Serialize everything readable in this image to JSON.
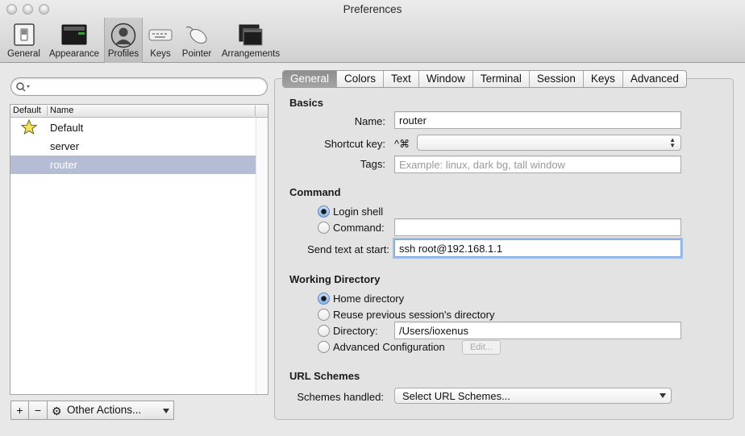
{
  "window": {
    "title": "Preferences"
  },
  "toolbar": {
    "items": [
      {
        "label": "General",
        "icon": "switch-icon"
      },
      {
        "label": "Appearance",
        "icon": "display-icon"
      },
      {
        "label": "Profiles",
        "icon": "user-silhouette-icon",
        "selected": true
      },
      {
        "label": "Keys",
        "icon": "keyboard-icon"
      },
      {
        "label": "Pointer",
        "icon": "mouse-icon"
      },
      {
        "label": "Arrangements",
        "icon": "windows-icon"
      }
    ]
  },
  "profiles_panel": {
    "search": {
      "placeholder": "",
      "value": ""
    },
    "columns": {
      "default": "Default",
      "name": "Name"
    },
    "profiles": [
      {
        "name": "Default",
        "is_default": true
      },
      {
        "name": "server",
        "is_default": false
      },
      {
        "name": "router",
        "is_default": false,
        "selected": true
      }
    ],
    "buttons": {
      "add": "+",
      "remove": "−",
      "other_actions": "Other Actions..."
    }
  },
  "tabs": [
    "General",
    "Colors",
    "Text",
    "Window",
    "Terminal",
    "Session",
    "Keys",
    "Advanced"
  ],
  "active_tab": "General",
  "general": {
    "basics": {
      "title": "Basics",
      "name_label": "Name:",
      "name_value": "router",
      "shortcut_label": "Shortcut key:",
      "shortcut_prefix": "^⌘",
      "shortcut_value": "",
      "tags_label": "Tags:",
      "tags_placeholder": "Example: linux, dark bg, tall window"
    },
    "command": {
      "title": "Command",
      "login_shell_label": "Login shell",
      "login_shell_selected": true,
      "command_label": "Command:",
      "command_value": "",
      "send_text_label": "Send text at start:",
      "send_text_value": "ssh root@192.168.1.1"
    },
    "working_directory": {
      "title": "Working Directory",
      "home_label": "Home directory",
      "home_selected": true,
      "reuse_label": "Reuse previous session's directory",
      "directory_label": "Directory:",
      "directory_value": "/Users/ioxenus",
      "advanced_label": "Advanced Configuration",
      "edit_button": "Edit..."
    },
    "url_schemes": {
      "title": "URL Schemes",
      "handled_label": "Schemes handled:",
      "select_value": "Select URL Schemes..."
    }
  }
}
